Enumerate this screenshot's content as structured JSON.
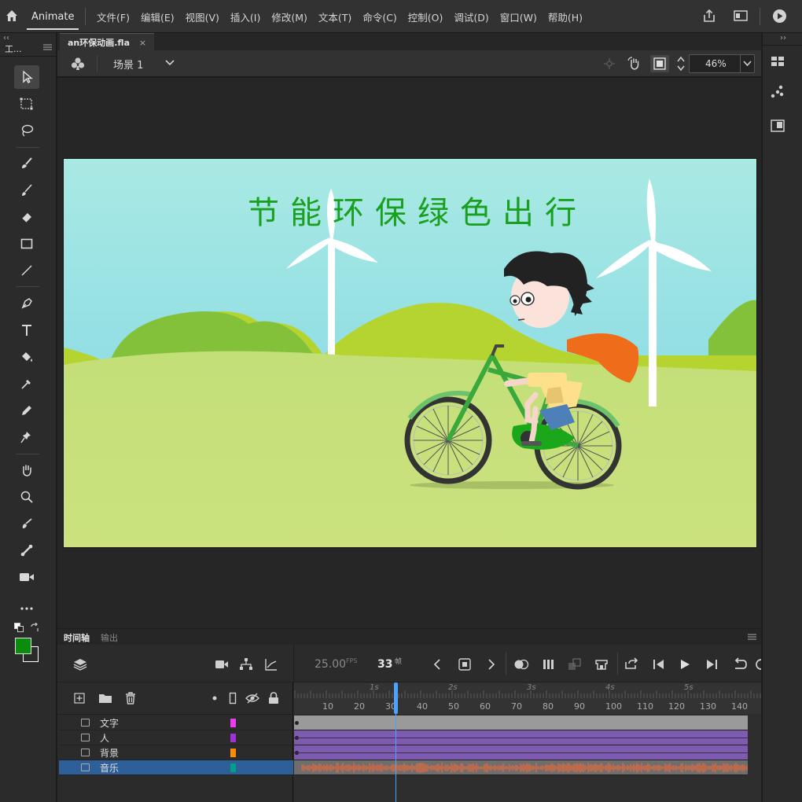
{
  "app": {
    "name": "Animate",
    "menu": [
      "文件(F)",
      "编辑(E)",
      "视图(V)",
      "插入(I)",
      "修改(M)",
      "文本(T)",
      "命令(C)",
      "控制(O)",
      "调试(D)",
      "窗口(W)",
      "帮助(H)"
    ]
  },
  "tools_panel": {
    "title": "工..."
  },
  "document": {
    "tab_name": "an环保动画.fla",
    "scene": "场景 1",
    "zoom": "46%"
  },
  "stage": {
    "title_text": "节能环保绿色出行",
    "colors": {
      "sky_top": "#a8e8e4",
      "sky_bottom": "#7dd6e4",
      "ground": "#c6e07a",
      "hill_green": "#86c43c",
      "hill_yellow": "#b9d632",
      "title_green": "#19a01e"
    }
  },
  "timeline": {
    "tabs": [
      "时间轴",
      "输出"
    ],
    "fps": "25.00",
    "fps_unit": "FPS",
    "frame": "33",
    "frame_unit": "帧",
    "ruler_numbers": [
      "10",
      "20",
      "30",
      "40",
      "50",
      "60",
      "70",
      "80",
      "90",
      "100",
      "110",
      "120",
      "130",
      "140"
    ],
    "ruler_seconds": [
      "1s",
      "2s",
      "3s",
      "4s",
      "5s"
    ],
    "layers": [
      {
        "name": "文字",
        "color": "#ee3bee"
      },
      {
        "name": "人",
        "color": "#9c32d8"
      },
      {
        "name": "背景",
        "color": "#ff8c00"
      },
      {
        "name": "音乐",
        "color": "#00a08a"
      }
    ]
  },
  "colors": {
    "fill_swatch": "#0c8c0c",
    "stroke_swatch": "#ffffff",
    "accent_blue": "#4aa3ff",
    "selected_layer": "#2f5f98"
  }
}
